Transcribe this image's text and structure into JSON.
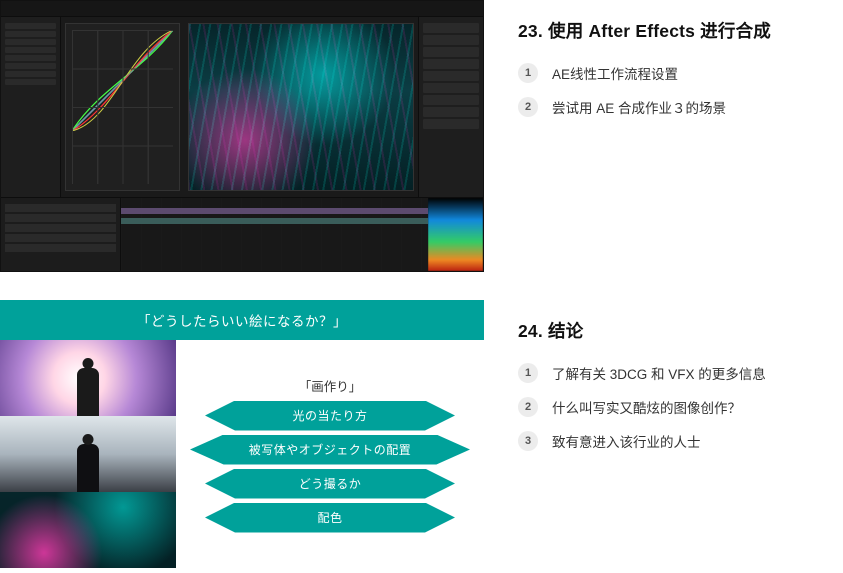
{
  "sections": [
    {
      "number": "23.",
      "title": "使用 After Effects 进行合成",
      "steps": [
        {
          "num": "1",
          "text": "AE线性工作流程设置"
        },
        {
          "num": "2",
          "text": "尝试用 AE 合成作业３的场景"
        }
      ],
      "thumb": {
        "kind": "after-effects-screenshot",
        "description": "Adobe After Effects UI with curves panel and neon cyberpunk composite in viewer"
      }
    },
    {
      "number": "24.",
      "title": "结论",
      "steps": [
        {
          "num": "1",
          "text": "了解有关 3DCG 和 VFX 的更多信息"
        },
        {
          "num": "2",
          "text": "什么叫写实又酷炫的图像创作？"
        },
        {
          "num": "3",
          "text": "致有意进入该行业的人士"
        }
      ],
      "thumb": {
        "kind": "presentation-slide",
        "header": "「どうしたらいい絵になるか？」",
        "subhead": "「画作り」",
        "items": [
          "光の当たり方",
          "被写体やオブジェクトの配置",
          "どう撮るか",
          "配色"
        ]
      }
    }
  ],
  "colors": {
    "teal": "#00a19a",
    "badge_bg": "#ececec"
  }
}
